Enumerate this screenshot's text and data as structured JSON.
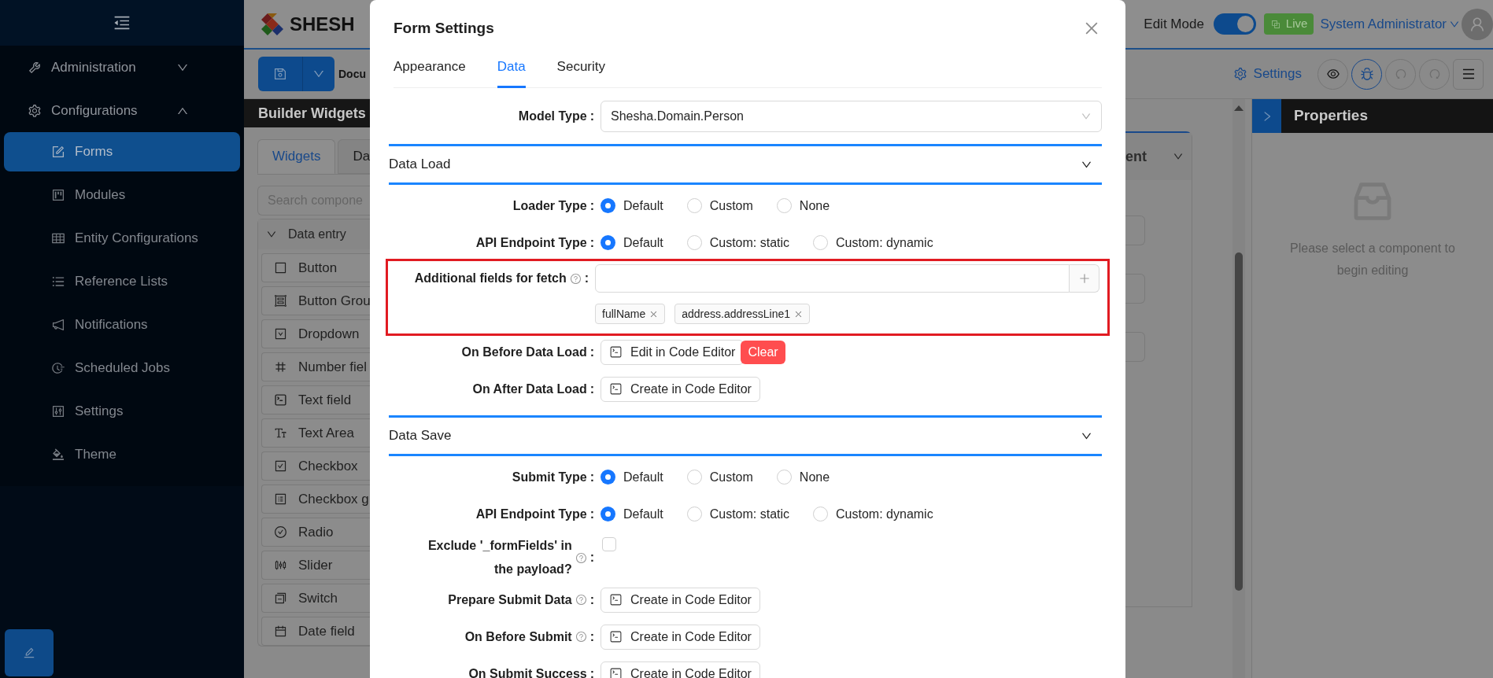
{
  "sidebar": {
    "items": [
      {
        "label": "Administration",
        "expanded": false
      },
      {
        "label": "Configurations",
        "expanded": true,
        "children": [
          {
            "label": "Forms",
            "selected": true
          },
          {
            "label": "Modules",
            "selected": false
          },
          {
            "label": "Entity Configurations",
            "selected": false
          },
          {
            "label": "Reference Lists",
            "selected": false
          },
          {
            "label": "Notifications",
            "selected": false
          },
          {
            "label": "Scheduled Jobs",
            "selected": false
          },
          {
            "label": "Settings",
            "selected": false
          },
          {
            "label": "Theme",
            "selected": false
          }
        ]
      }
    ]
  },
  "header": {
    "logo_text": "SHESH",
    "edit_mode": {
      "label": "Edit Mode",
      "on": true
    },
    "live_badge": "Live",
    "user": "System Administrator"
  },
  "toolbar": {
    "document_title": "Docu",
    "settings": "Settings"
  },
  "builder": {
    "title": "Builder Widgets",
    "tabs": [
      {
        "label": "Widgets",
        "selected": true
      },
      {
        "label": "Da",
        "selected": false
      }
    ],
    "search": {
      "placeholder": "Search compone"
    },
    "group": {
      "label": "Data entry",
      "expanded": true,
      "widgets": [
        "Button",
        "Button Grou",
        "Dropdown",
        "Number fiel",
        "Text field",
        "Text Area",
        "Checkbox",
        "Checkbox g",
        "Radio",
        "Slider",
        "Switch",
        "Date field"
      ]
    }
  },
  "canvas": {
    "component_header": "ent"
  },
  "properties": {
    "title": "Properties",
    "empty_text": "Please select a component to begin editing"
  },
  "modal": {
    "title": "Form Settings",
    "tabs": [
      {
        "label": "Appearance",
        "selected": false
      },
      {
        "label": "Data",
        "selected": true
      },
      {
        "label": "Security",
        "selected": false
      }
    ],
    "model_type": {
      "label": "Model Type",
      "colon": ":",
      "value": "Shesha.Domain.Person"
    },
    "sections": [
      {
        "title": "Data Load",
        "expanded": true,
        "rows": [
          {
            "kind": "radio",
            "label": "Loader Type",
            "colon": ":",
            "options": [
              {
                "label": "Default",
                "selected": true
              },
              {
                "label": "Custom",
                "selected": false
              },
              {
                "label": "None",
                "selected": false
              }
            ]
          },
          {
            "kind": "radio",
            "label": "API Endpoint Type",
            "colon": ":",
            "options": [
              {
                "label": "Default",
                "selected": true
              },
              {
                "label": "Custom: static",
                "selected": false
              },
              {
                "label": "Custom: dynamic",
                "selected": false
              }
            ]
          },
          {
            "kind": "tags",
            "label": "Additional fields for fetch",
            "colon": ":",
            "help": true,
            "highlighted": true,
            "tags": [
              "fullName",
              "address.addressLine1"
            ]
          },
          {
            "kind": "code",
            "label": "On Before Data Load",
            "colon": ":",
            "button": "Edit in Code Editor",
            "clear": "Clear"
          },
          {
            "kind": "code",
            "label": "On After Data Load",
            "colon": ":",
            "button": "Create in Code Editor"
          }
        ]
      },
      {
        "title": "Data Save",
        "expanded": true,
        "rows": [
          {
            "kind": "radio",
            "label": "Submit Type",
            "colon": ":",
            "options": [
              {
                "label": "Default",
                "selected": true
              },
              {
                "label": "Custom",
                "selected": false
              },
              {
                "label": "None",
                "selected": false
              }
            ]
          },
          {
            "kind": "radio",
            "label": "API Endpoint Type",
            "colon": ":",
            "options": [
              {
                "label": "Default",
                "selected": true
              },
              {
                "label": "Custom: static",
                "selected": false
              },
              {
                "label": "Custom: dynamic",
                "selected": false
              }
            ]
          },
          {
            "kind": "checkbox",
            "label": "Exclude '_formFields' in the payload?",
            "colon": ":",
            "help": true,
            "checked": false
          },
          {
            "kind": "code",
            "label": "Prepare Submit Data",
            "colon": ":",
            "help": true,
            "button": "Create in Code Editor"
          },
          {
            "kind": "code",
            "label": "On Before Submit",
            "colon": ":",
            "help": true,
            "button": "Create in Code Editor"
          },
          {
            "kind": "code",
            "label": "On Submit Success",
            "colon": ":",
            "button": "Create in Code Editor"
          }
        ]
      }
    ]
  }
}
